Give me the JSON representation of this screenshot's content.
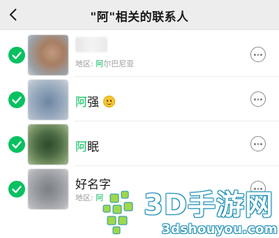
{
  "header": {
    "title": "\"阿\"相关的联系人",
    "back_icon": "chevron-left-icon"
  },
  "colors": {
    "accent": "#07c160",
    "header_bg": "#ededed",
    "secondary_text": "#9a9a9a",
    "watermark": "#1c8fb5"
  },
  "contacts": [
    {
      "name_highlight": "",
      "name_rest": "",
      "region_label": "地区: ",
      "region_highlight": "阿",
      "region_rest": "尔巴尼亚",
      "selected": true,
      "more_icon": "more-options-icon"
    },
    {
      "name_highlight": "阿",
      "name_rest": "强",
      "emoji": "smile-emoji-icon",
      "selected": true,
      "more_icon": "more-options-icon"
    },
    {
      "name_highlight": "阿",
      "name_rest": "眠",
      "selected": true,
      "more_icon": "more-options-icon"
    },
    {
      "name_highlight": "",
      "name_rest": "好名字",
      "region_label": "地区: ",
      "region_highlight": "阿",
      "region_rest": "",
      "selected": true,
      "more_icon": "more-options-icon"
    }
  ],
  "watermark": {
    "title": "3D手游网",
    "url": "3dshouyou.com"
  }
}
